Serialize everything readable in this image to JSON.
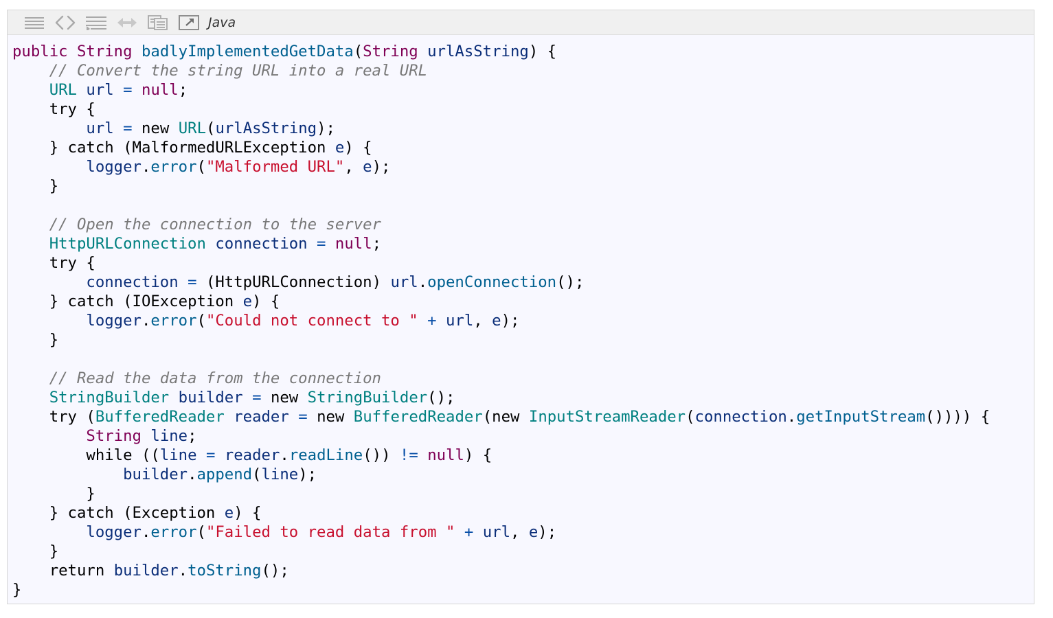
{
  "toolbar": {
    "icons": [
      "view-source-icon",
      "code-icon",
      "wrap-icon",
      "expand-icon",
      "copy-icon",
      "popup-icon"
    ],
    "language": "Java"
  },
  "code": {
    "lines": [
      [
        {
          "t": "kw",
          "v": "public"
        },
        {
          "t": "p",
          "v": " "
        },
        {
          "t": "kw",
          "v": "String"
        },
        {
          "t": "p",
          "v": " "
        },
        {
          "t": "fn",
          "v": "badlyImplementedGetData"
        },
        {
          "t": "p",
          "v": "("
        },
        {
          "t": "kw",
          "v": "String"
        },
        {
          "t": "p",
          "v": " "
        },
        {
          "t": "id",
          "v": "urlAsString"
        },
        {
          "t": "p",
          "v": ") {"
        }
      ],
      [
        {
          "t": "p",
          "v": "    "
        },
        {
          "t": "cm",
          "v": "// Convert the string URL into a real URL"
        }
      ],
      [
        {
          "t": "p",
          "v": "    "
        },
        {
          "t": "ty",
          "v": "URL"
        },
        {
          "t": "p",
          "v": " "
        },
        {
          "t": "id",
          "v": "url"
        },
        {
          "t": "p",
          "v": " "
        },
        {
          "t": "op",
          "v": "="
        },
        {
          "t": "p",
          "v": " "
        },
        {
          "t": "nu",
          "v": "null"
        },
        {
          "t": "p",
          "v": ";"
        }
      ],
      [
        {
          "t": "p",
          "v": "    "
        },
        {
          "t": "kw2",
          "v": "try"
        },
        {
          "t": "p",
          "v": " {"
        }
      ],
      [
        {
          "t": "p",
          "v": "        "
        },
        {
          "t": "id",
          "v": "url"
        },
        {
          "t": "p",
          "v": " "
        },
        {
          "t": "op",
          "v": "="
        },
        {
          "t": "p",
          "v": " "
        },
        {
          "t": "kw2",
          "v": "new"
        },
        {
          "t": "p",
          "v": " "
        },
        {
          "t": "ty",
          "v": "URL"
        },
        {
          "t": "p",
          "v": "("
        },
        {
          "t": "id",
          "v": "urlAsString"
        },
        {
          "t": "p",
          "v": ");"
        }
      ],
      [
        {
          "t": "p",
          "v": "    } "
        },
        {
          "t": "kw2",
          "v": "catch"
        },
        {
          "t": "p",
          "v": " (MalformedURLException "
        },
        {
          "t": "id",
          "v": "e"
        },
        {
          "t": "p",
          "v": ") {"
        }
      ],
      [
        {
          "t": "p",
          "v": "        "
        },
        {
          "t": "id",
          "v": "logger"
        },
        {
          "t": "p",
          "v": "."
        },
        {
          "t": "fn",
          "v": "error"
        },
        {
          "t": "p",
          "v": "("
        },
        {
          "t": "st",
          "v": "\"Malformed URL\""
        },
        {
          "t": "p",
          "v": ", "
        },
        {
          "t": "id",
          "v": "e"
        },
        {
          "t": "p",
          "v": ");"
        }
      ],
      [
        {
          "t": "p",
          "v": "    }"
        }
      ],
      [
        {
          "t": "p",
          "v": ""
        }
      ],
      [
        {
          "t": "p",
          "v": "    "
        },
        {
          "t": "cm",
          "v": "// Open the connection to the server"
        }
      ],
      [
        {
          "t": "p",
          "v": "    "
        },
        {
          "t": "ty",
          "v": "HttpURLConnection"
        },
        {
          "t": "p",
          "v": " "
        },
        {
          "t": "id",
          "v": "connection"
        },
        {
          "t": "p",
          "v": " "
        },
        {
          "t": "op",
          "v": "="
        },
        {
          "t": "p",
          "v": " "
        },
        {
          "t": "nu",
          "v": "null"
        },
        {
          "t": "p",
          "v": ";"
        }
      ],
      [
        {
          "t": "p",
          "v": "    "
        },
        {
          "t": "kw2",
          "v": "try"
        },
        {
          "t": "p",
          "v": " {"
        }
      ],
      [
        {
          "t": "p",
          "v": "        "
        },
        {
          "t": "id",
          "v": "connection"
        },
        {
          "t": "p",
          "v": " "
        },
        {
          "t": "op",
          "v": "="
        },
        {
          "t": "p",
          "v": " (HttpURLConnection) "
        },
        {
          "t": "id",
          "v": "url"
        },
        {
          "t": "p",
          "v": "."
        },
        {
          "t": "fn",
          "v": "openConnection"
        },
        {
          "t": "p",
          "v": "();"
        }
      ],
      [
        {
          "t": "p",
          "v": "    } "
        },
        {
          "t": "kw2",
          "v": "catch"
        },
        {
          "t": "p",
          "v": " (IOException "
        },
        {
          "t": "id",
          "v": "e"
        },
        {
          "t": "p",
          "v": ") {"
        }
      ],
      [
        {
          "t": "p",
          "v": "        "
        },
        {
          "t": "id",
          "v": "logger"
        },
        {
          "t": "p",
          "v": "."
        },
        {
          "t": "fn",
          "v": "error"
        },
        {
          "t": "p",
          "v": "("
        },
        {
          "t": "st",
          "v": "\"Could not connect to \""
        },
        {
          "t": "p",
          "v": " "
        },
        {
          "t": "op",
          "v": "+"
        },
        {
          "t": "p",
          "v": " "
        },
        {
          "t": "id",
          "v": "url"
        },
        {
          "t": "p",
          "v": ", "
        },
        {
          "t": "id",
          "v": "e"
        },
        {
          "t": "p",
          "v": ");"
        }
      ],
      [
        {
          "t": "p",
          "v": "    }"
        }
      ],
      [
        {
          "t": "p",
          "v": ""
        }
      ],
      [
        {
          "t": "p",
          "v": "    "
        },
        {
          "t": "cm",
          "v": "// Read the data from the connection"
        }
      ],
      [
        {
          "t": "p",
          "v": "    "
        },
        {
          "t": "ty",
          "v": "StringBuilder"
        },
        {
          "t": "p",
          "v": " "
        },
        {
          "t": "id",
          "v": "builder"
        },
        {
          "t": "p",
          "v": " "
        },
        {
          "t": "op",
          "v": "="
        },
        {
          "t": "p",
          "v": " "
        },
        {
          "t": "kw2",
          "v": "new"
        },
        {
          "t": "p",
          "v": " "
        },
        {
          "t": "ty",
          "v": "StringBuilder"
        },
        {
          "t": "p",
          "v": "();"
        }
      ],
      [
        {
          "t": "p",
          "v": "    "
        },
        {
          "t": "kw2",
          "v": "try"
        },
        {
          "t": "p",
          "v": " ("
        },
        {
          "t": "ty",
          "v": "BufferedReader"
        },
        {
          "t": "p",
          "v": " "
        },
        {
          "t": "id",
          "v": "reader"
        },
        {
          "t": "p",
          "v": " "
        },
        {
          "t": "op",
          "v": "="
        },
        {
          "t": "p",
          "v": " "
        },
        {
          "t": "kw2",
          "v": "new"
        },
        {
          "t": "p",
          "v": " "
        },
        {
          "t": "ty",
          "v": "BufferedReader"
        },
        {
          "t": "p",
          "v": "("
        },
        {
          "t": "kw2",
          "v": "new"
        },
        {
          "t": "p",
          "v": " "
        },
        {
          "t": "ty",
          "v": "InputStreamReader"
        },
        {
          "t": "p",
          "v": "("
        },
        {
          "t": "id",
          "v": "connection"
        },
        {
          "t": "p",
          "v": "."
        },
        {
          "t": "fn",
          "v": "getInputStream"
        },
        {
          "t": "p",
          "v": "()))) {"
        }
      ],
      [
        {
          "t": "p",
          "v": "        "
        },
        {
          "t": "kw",
          "v": "String"
        },
        {
          "t": "p",
          "v": " "
        },
        {
          "t": "id",
          "v": "line"
        },
        {
          "t": "p",
          "v": ";"
        }
      ],
      [
        {
          "t": "p",
          "v": "        "
        },
        {
          "t": "kw2",
          "v": "while"
        },
        {
          "t": "p",
          "v": " (("
        },
        {
          "t": "id",
          "v": "line"
        },
        {
          "t": "p",
          "v": " "
        },
        {
          "t": "op",
          "v": "="
        },
        {
          "t": "p",
          "v": " "
        },
        {
          "t": "id",
          "v": "reader"
        },
        {
          "t": "p",
          "v": "."
        },
        {
          "t": "fn",
          "v": "readLine"
        },
        {
          "t": "p",
          "v": "()) "
        },
        {
          "t": "op",
          "v": "!="
        },
        {
          "t": "p",
          "v": " "
        },
        {
          "t": "nu",
          "v": "null"
        },
        {
          "t": "p",
          "v": ") {"
        }
      ],
      [
        {
          "t": "p",
          "v": "            "
        },
        {
          "t": "id",
          "v": "builder"
        },
        {
          "t": "p",
          "v": "."
        },
        {
          "t": "fn",
          "v": "append"
        },
        {
          "t": "p",
          "v": "("
        },
        {
          "t": "id",
          "v": "line"
        },
        {
          "t": "p",
          "v": ");"
        }
      ],
      [
        {
          "t": "p",
          "v": "        }"
        }
      ],
      [
        {
          "t": "p",
          "v": "    } "
        },
        {
          "t": "kw2",
          "v": "catch"
        },
        {
          "t": "p",
          "v": " (Exception "
        },
        {
          "t": "id",
          "v": "e"
        },
        {
          "t": "p",
          "v": ") {"
        }
      ],
      [
        {
          "t": "p",
          "v": "        "
        },
        {
          "t": "id",
          "v": "logger"
        },
        {
          "t": "p",
          "v": "."
        },
        {
          "t": "fn",
          "v": "error"
        },
        {
          "t": "p",
          "v": "("
        },
        {
          "t": "st",
          "v": "\"Failed to read data from \""
        },
        {
          "t": "p",
          "v": " "
        },
        {
          "t": "op",
          "v": "+"
        },
        {
          "t": "p",
          "v": " "
        },
        {
          "t": "id",
          "v": "url"
        },
        {
          "t": "p",
          "v": ", "
        },
        {
          "t": "id",
          "v": "e"
        },
        {
          "t": "p",
          "v": ");"
        }
      ],
      [
        {
          "t": "p",
          "v": "    }"
        }
      ],
      [
        {
          "t": "p",
          "v": "    "
        },
        {
          "t": "kw2",
          "v": "return"
        },
        {
          "t": "p",
          "v": " "
        },
        {
          "t": "id",
          "v": "builder"
        },
        {
          "t": "p",
          "v": "."
        },
        {
          "t": "fn",
          "v": "toString"
        },
        {
          "t": "p",
          "v": "();"
        }
      ],
      [
        {
          "t": "p",
          "v": "}"
        }
      ]
    ]
  }
}
